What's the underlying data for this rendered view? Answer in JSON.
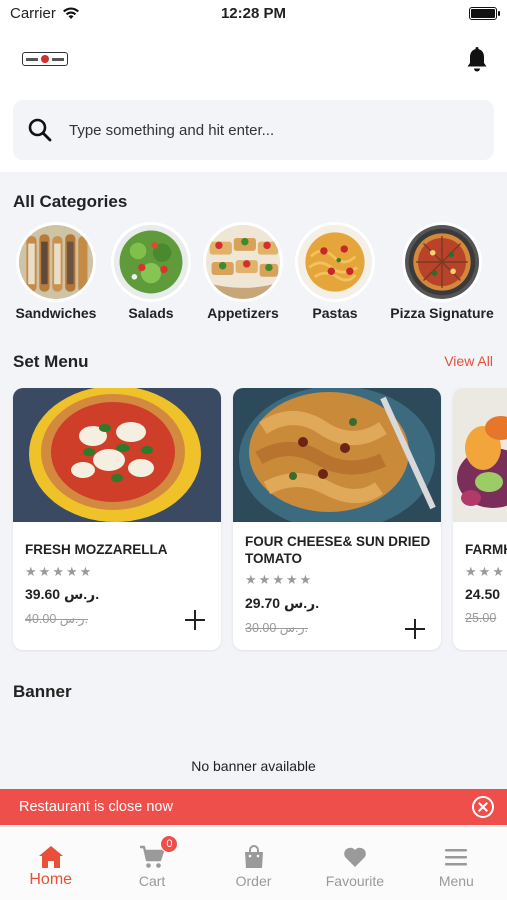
{
  "status_bar": {
    "carrier": "Carrier",
    "time": "12:28 PM"
  },
  "header": {
    "logo_icon": "brand-logo",
    "notification_icon": "bell-icon"
  },
  "search": {
    "placeholder": "Type something and hit enter...",
    "icon": "search-icon"
  },
  "categories": {
    "title": "All Categories",
    "items": [
      {
        "label": "Sandwiches"
      },
      {
        "label": "Salads"
      },
      {
        "label": "Appetizers"
      },
      {
        "label": "Pastas"
      },
      {
        "label": "Pizza Signature"
      }
    ]
  },
  "set_menu": {
    "title": "Set Menu",
    "view_all": "View All",
    "products": [
      {
        "name": "FRESH MOZZARELLA",
        "rating": 0,
        "price": "39.60 ر.س.",
        "old_price": "40.00 ر.س."
      },
      {
        "name": "FOUR CHEESE& SUN DRIED TOMATO",
        "rating": 0,
        "price": "29.70 ر.س.",
        "old_price": "30.00 ر.س."
      },
      {
        "name": "FARMHOUSE",
        "rating": 0,
        "price": "24.50",
        "old_price": "25.00"
      }
    ]
  },
  "banner": {
    "title": "Banner",
    "empty_text": "No banner available"
  },
  "restaurant_status": {
    "text": "Restaurant is close now"
  },
  "tab_bar": {
    "items": [
      {
        "label": "Home",
        "icon": "home-icon",
        "active": true
      },
      {
        "label": "Cart",
        "icon": "cart-icon",
        "badge": "0"
      },
      {
        "label": "Order",
        "icon": "bag-icon"
      },
      {
        "label": "Favourite",
        "icon": "heart-icon"
      },
      {
        "label": "Menu",
        "icon": "menu-icon"
      }
    ]
  },
  "colors": {
    "accent": "#e8503a",
    "closed_bar": "#ef4f4a",
    "background": "#f2f4f8",
    "inactive": "#9a9a9a"
  }
}
